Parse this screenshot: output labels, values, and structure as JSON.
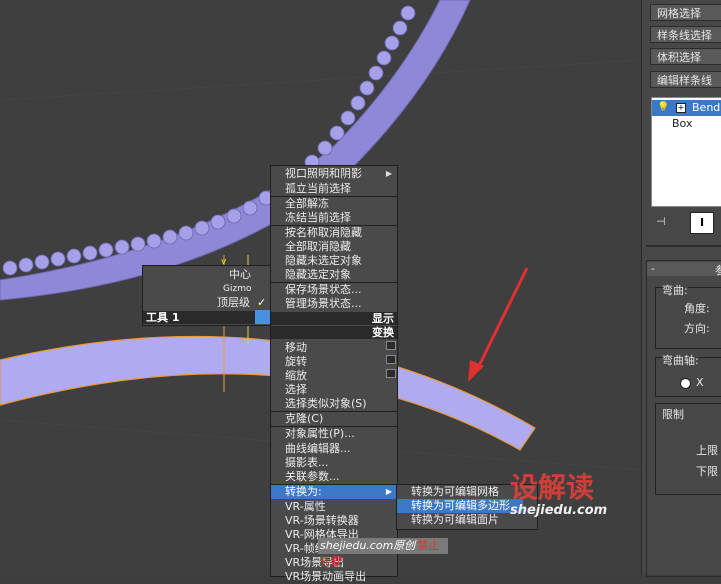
{
  "quad_left": {
    "items": [
      "中心",
      "Gizmo",
      "顶层级"
    ],
    "check": "✓",
    "header": "工具 1"
  },
  "quad_right": {
    "top_items": [
      "视口照明和阴影",
      "孤立当前选择",
      "全部解冻",
      "冻结当前选择",
      "按名称取消隐藏",
      "全部取消隐藏",
      "隐藏未选定对象",
      "隐藏选定对象",
      "保存场景状态...",
      "管理场景状态..."
    ],
    "header_display": "显示",
    "header_transform": "变换",
    "bottom_items": [
      "移动",
      "旋转",
      "缩放",
      "选择",
      "选择类似对象(S)",
      "克隆(C)",
      "对象属性(P)...",
      "曲线编辑器...",
      "摄影表...",
      "关联参数...",
      "转换为:",
      "VR-属性",
      "VR-场景转换器",
      "VR-网格体导出",
      "VR-帧缓冲区",
      "VR场景导出",
      "VR场景动画导出"
    ]
  },
  "submenu": {
    "items": [
      "转换为可编辑网格",
      "转换为可编辑多边形",
      "转换为可编辑面片"
    ]
  },
  "panel": {
    "buttons": [
      "网格选择",
      "样条线选择",
      "体积选择",
      "编辑样条线"
    ],
    "stack": [
      "Bend",
      "Box"
    ],
    "rollout_sign": "-",
    "rollout_title": "参",
    "bend_group": "弯曲:",
    "angle": "角度:",
    "direction": "方向:",
    "axis_group": "弯曲轴:",
    "axis_x": "X",
    "limits_group": "限制",
    "upper": "上限",
    "lower": "下限"
  },
  "watermark": {
    "logo": "设解读",
    "url": "shejiedu.com",
    "caption_site": "shejiedu.com原创",
    "caption_warn": "禁止转载"
  }
}
